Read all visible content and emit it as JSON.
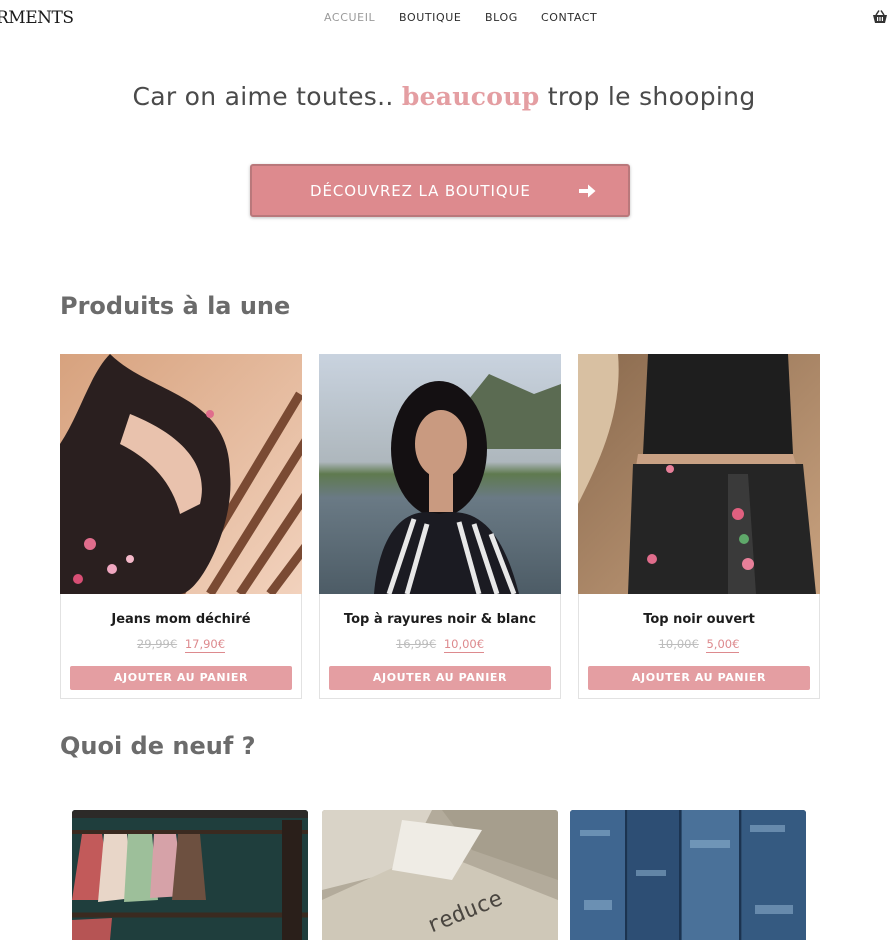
{
  "colors": {
    "accent": "#e49ea2",
    "accent_dark": "#dd8a8e",
    "heading": "#6b6b6b"
  },
  "header": {
    "logo": "RMENTS",
    "nav": [
      {
        "label": "ACCUEIL",
        "active": true
      },
      {
        "label": "BOUTIQUE"
      },
      {
        "label": "BLOG"
      },
      {
        "label": "CONTACT"
      }
    ],
    "cart_icon": "basket-icon"
  },
  "hero": {
    "tagline_before": "Car on aime toutes..",
    "tagline_accent": "beaucoup",
    "tagline_after": "trop le shooping",
    "cta_label": "DÉCOUVREZ LA BOUTIQUE",
    "cta_icon": "arrow-right-icon"
  },
  "featured": {
    "title": "Produits à la une",
    "products": [
      {
        "name": "Jeans mom déchiré",
        "old_price": "29,99€",
        "price": "17,90€",
        "button": "AJOUTER AU PANIER"
      },
      {
        "name": "Top à rayures noir & blanc",
        "old_price": "16,99€",
        "price": "10,00€",
        "button": "AJOUTER AU PANIER"
      },
      {
        "name": "Top noir ouvert",
        "old_price": "10,00€",
        "price": "5,00€",
        "button": "AJOUTER AU PANIER"
      }
    ]
  },
  "news": {
    "title": "Quoi de neuf ?",
    "posts": [
      {
        "image": "clothing-rack-image"
      },
      {
        "image": "cardboard-reduce-image",
        "image_text": "reduce"
      },
      {
        "image": "denim-jeans-image"
      }
    ]
  }
}
